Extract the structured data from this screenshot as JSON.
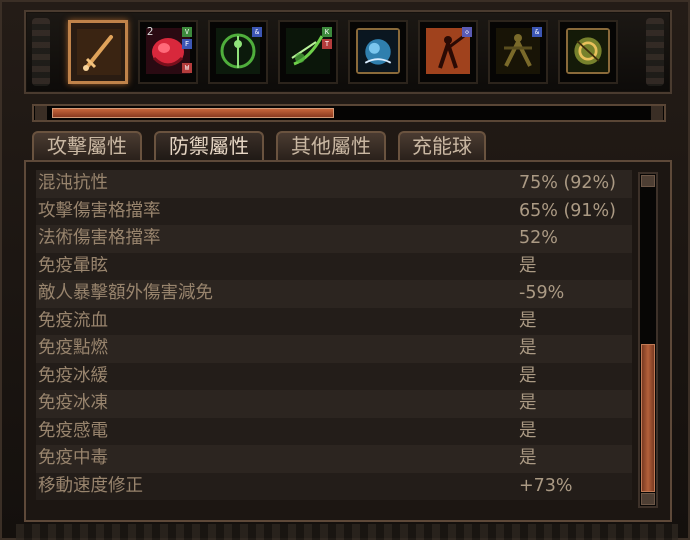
{
  "skills": [
    {
      "icon": "sword-icon",
      "selected": true,
      "color": "#c98f52",
      "marks": []
    },
    {
      "icon": "red-beast-icon",
      "selected": false,
      "color": "#d8283c",
      "marks": [
        "2",
        "V",
        "F",
        "W"
      ]
    },
    {
      "icon": "green-archer-icon",
      "selected": false,
      "color": "#4fae3c",
      "marks": [
        "&"
      ]
    },
    {
      "icon": "green-bow-icon",
      "selected": false,
      "color": "#6fd04a",
      "marks": [
        "K",
        "T"
      ]
    },
    {
      "icon": "blue-orb-icon",
      "selected": false,
      "color": "#2f7fae",
      "marks": []
    },
    {
      "icon": "fire-warrior-icon",
      "selected": false,
      "color": "#e4622a",
      "marks": [
        "◇"
      ]
    },
    {
      "icon": "dim-warrior-icon",
      "selected": false,
      "color": "#7a6a2a",
      "marks": [
        "&"
      ]
    },
    {
      "icon": "green-gold-shield-icon",
      "selected": false,
      "color": "#9fae3c",
      "marks": []
    }
  ],
  "progress": 0.47,
  "tabs": [
    {
      "label": "攻擊屬性",
      "active": false
    },
    {
      "label": "防禦屬性",
      "active": true
    },
    {
      "label": "其他屬性",
      "active": false
    },
    {
      "label": "充能球",
      "active": false
    }
  ],
  "stats": [
    {
      "label": "混沌抗性",
      "value": "75% (92%)"
    },
    {
      "label": "攻擊傷害格擋率",
      "value": "65% (91%)"
    },
    {
      "label": "法術傷害格擋率",
      "value": "52%"
    },
    {
      "label": "免疫暈眩",
      "value": "是"
    },
    {
      "label": "敵人暴擊額外傷害減免",
      "value": "-59%"
    },
    {
      "label": "免疫流血",
      "value": "是"
    },
    {
      "label": "免疫點燃",
      "value": "是"
    },
    {
      "label": "免疫冰緩",
      "value": "是"
    },
    {
      "label": "免疫冰凍",
      "value": "是"
    },
    {
      "label": "免疫感電",
      "value": "是"
    },
    {
      "label": "免疫中毒",
      "value": "是"
    },
    {
      "label": "移動速度修正",
      "value": "+73%"
    }
  ]
}
